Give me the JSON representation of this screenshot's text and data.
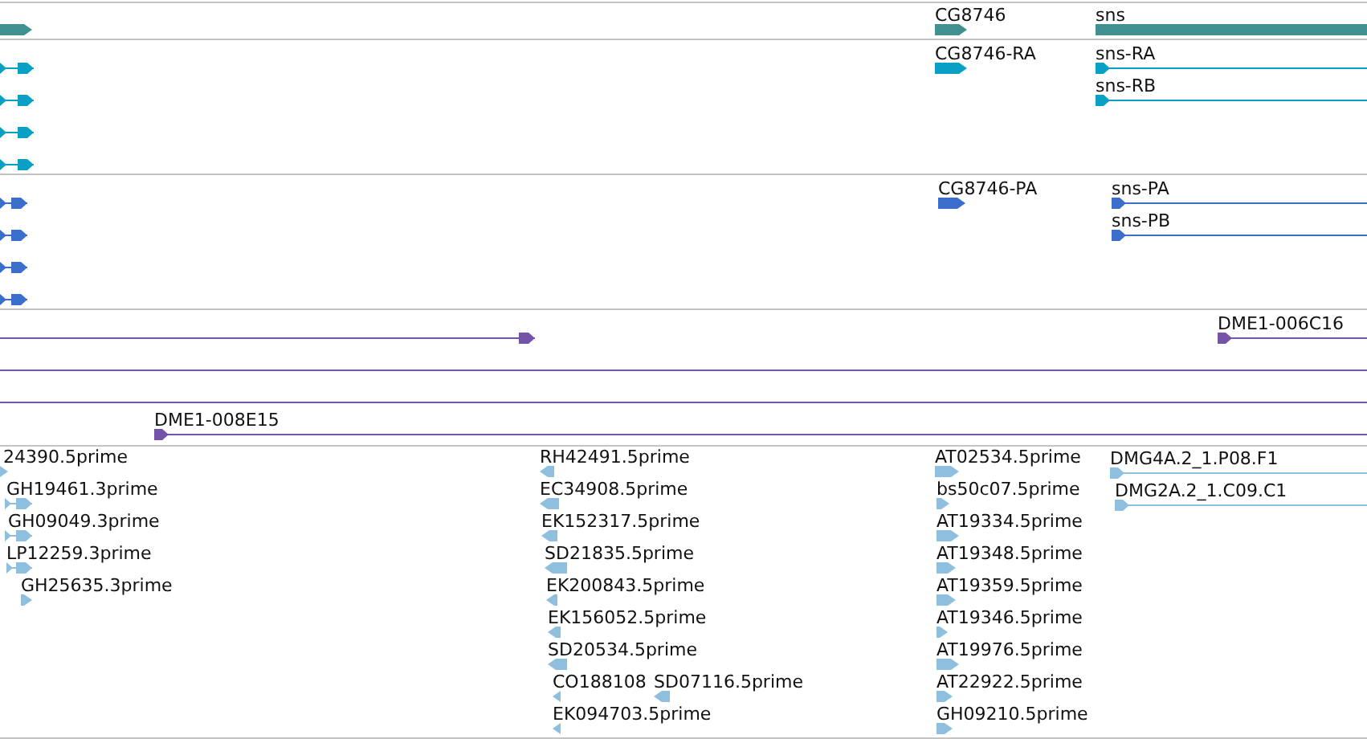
{
  "tracks": [
    {
      "kind": "gene",
      "features": [
        {
          "kind": "bar",
          "reverse": false
        },
        {
          "kind": "bar",
          "label": "CG8746",
          "reverse": false
        },
        {
          "kind": "box",
          "label": "sns"
        }
      ]
    },
    {
      "kind": "transcript",
      "features": [
        {
          "kind": "split",
          "reverse": false
        },
        {
          "kind": "split",
          "reverse": false
        },
        {
          "kind": "split",
          "reverse": false
        },
        {
          "kind": "split",
          "reverse": false
        },
        {
          "kind": "bar",
          "label": "CG8746-RA",
          "reverse": false
        },
        {
          "kind": "line",
          "label": "sns-RA",
          "reverse": false
        },
        {
          "kind": "line",
          "label": "sns-RB",
          "reverse": false
        }
      ]
    },
    {
      "kind": "protein",
      "features": [
        {
          "kind": "split",
          "reverse": false
        },
        {
          "kind": "split",
          "reverse": false
        },
        {
          "kind": "split",
          "reverse": false
        },
        {
          "kind": "split",
          "reverse": false
        },
        {
          "kind": "bar",
          "label": "CG8746-PA",
          "reverse": false
        },
        {
          "kind": "line",
          "label": "sns-PA",
          "reverse": false
        },
        {
          "kind": "line",
          "label": "sns-PB",
          "reverse": false
        }
      ]
    },
    {
      "kind": "clone",
      "features": [
        {
          "kind": "lineend",
          "reverse": false
        },
        {
          "kind": "line",
          "label": "DME1-006C16",
          "reverse": false
        },
        {
          "kind": "plain"
        },
        {
          "kind": "plain"
        },
        {
          "kind": "line",
          "label": "DME1-008E15",
          "reverse": false
        }
      ]
    },
    {
      "kind": "est",
      "features": [
        {
          "kind": "bar",
          "label": "24390.5prime",
          "reverse": false
        },
        {
          "kind": "split",
          "label": "GH19461.3prime",
          "reverse": false
        },
        {
          "kind": "split",
          "label": "GH09049.3prime",
          "reverse": false
        },
        {
          "kind": "split",
          "label": "LP12259.3prime",
          "reverse": false
        },
        {
          "kind": "bar",
          "label": "GH25635.3prime",
          "reverse": false
        },
        {
          "kind": "bar",
          "label": "RH42491.5prime",
          "reverse": true
        },
        {
          "kind": "bar",
          "label": "EC34908.5prime",
          "reverse": true
        },
        {
          "kind": "bar",
          "label": "EK152317.5prime",
          "reverse": true
        },
        {
          "kind": "bar",
          "label": "SD21835.5prime",
          "reverse": true
        },
        {
          "kind": "bar",
          "label": "EK200843.5prime",
          "reverse": true
        },
        {
          "kind": "bar",
          "label": "EK156052.5prime",
          "reverse": true
        },
        {
          "kind": "bar",
          "label": "SD20534.5prime",
          "reverse": true
        },
        {
          "kind": "bar",
          "label": "CO188108",
          "reverse": true
        },
        {
          "kind": "bar",
          "label": "SD07116.5prime",
          "reverse": true
        },
        {
          "kind": "bar",
          "label": "EK094703.5prime",
          "reverse": true
        },
        {
          "kind": "bar",
          "label": "AT02534.5prime",
          "reverse": false
        },
        {
          "kind": "bar",
          "label": "bs50c07.5prime",
          "reverse": false
        },
        {
          "kind": "bar",
          "label": "AT19334.5prime",
          "reverse": false
        },
        {
          "kind": "bar",
          "label": "AT19348.5prime",
          "reverse": false
        },
        {
          "kind": "bar",
          "label": "AT19359.5prime",
          "reverse": false
        },
        {
          "kind": "bar",
          "label": "AT19346.5prime",
          "reverse": false
        },
        {
          "kind": "bar",
          "label": "AT19976.5prime",
          "reverse": false
        },
        {
          "kind": "bar",
          "label": "AT22922.5prime",
          "reverse": false
        },
        {
          "kind": "bar",
          "label": "GH09210.5prime",
          "reverse": false
        },
        {
          "kind": "line",
          "label": "DMG4A.2_1.P08.F1",
          "reverse": false
        },
        {
          "kind": "line",
          "label": "DMG2A.2_1.C09.C1",
          "reverse": false
        }
      ]
    }
  ]
}
